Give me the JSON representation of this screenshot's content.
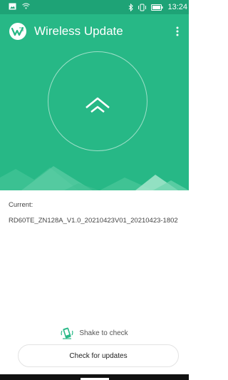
{
  "status_bar": {
    "time": "13:24",
    "icons": [
      "image-icon",
      "wifi-icon",
      "bluetooth-icon",
      "vibrate-icon",
      "battery-icon"
    ]
  },
  "app_bar": {
    "title": "Wireless Update",
    "logo": "app-logo-icon",
    "menu_icon": "more-vert-icon"
  },
  "hero": {
    "update_icon": "chevron-up-icon"
  },
  "current": {
    "label": "Current:",
    "version": "RD60TE_ZN128A_V1.0_20210423V01_20210423-1802"
  },
  "shake": {
    "label": "Shake to check",
    "icon": "shake-phone-icon"
  },
  "check_button": {
    "label": "Check for updates"
  },
  "colors": {
    "status_bar": "#1ea376",
    "header": "#27b886",
    "text": "#444444"
  }
}
